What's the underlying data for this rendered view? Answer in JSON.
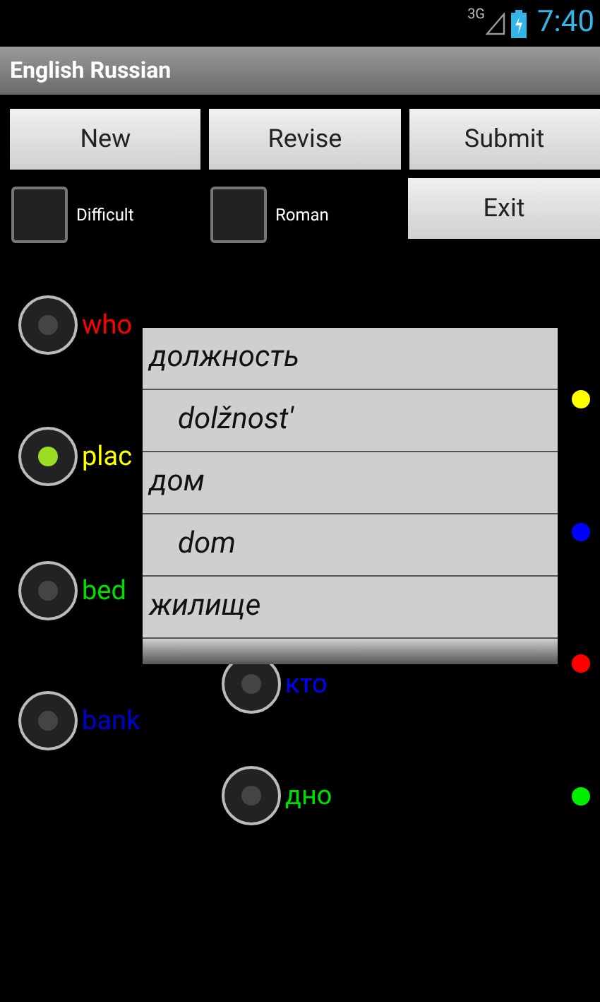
{
  "status_bar": {
    "network": "3G",
    "time": "7:40"
  },
  "window": {
    "title": "English Russian"
  },
  "buttons": [
    "New",
    "Revise",
    "Submit"
  ],
  "checkboxes": [
    {
      "label": "Difficult",
      "checked": false
    },
    {
      "label": "Roman",
      "checked": false
    }
  ],
  "exit_button": "Exit",
  "options": [
    {
      "label": "who",
      "color": "#ff0000",
      "selected": false
    },
    {
      "label": "plac",
      "color": "#ffff00",
      "selected": true
    },
    {
      "label": "bed",
      "color": "#00dd00",
      "selected": false
    },
    {
      "label": "bank",
      "color": "#0000cc",
      "selected": false
    },
    {
      "label": "кто",
      "color": "#0000ff",
      "selected": false
    },
    {
      "label": "дно",
      "color": "#00dd00",
      "selected": false
    }
  ],
  "dots": [
    {
      "color": "#ffff00"
    },
    {
      "color": "#0000ff"
    },
    {
      "color": "#ff0000"
    },
    {
      "color": "#00ee00"
    }
  ],
  "popup": [
    {
      "kind": "word",
      "text": "должность"
    },
    {
      "kind": "transliteration",
      "text": "dolžnost'"
    },
    {
      "kind": "word",
      "text": "дом"
    },
    {
      "kind": "transliteration",
      "text": "dom"
    },
    {
      "kind": "word",
      "text": "жилище"
    }
  ]
}
